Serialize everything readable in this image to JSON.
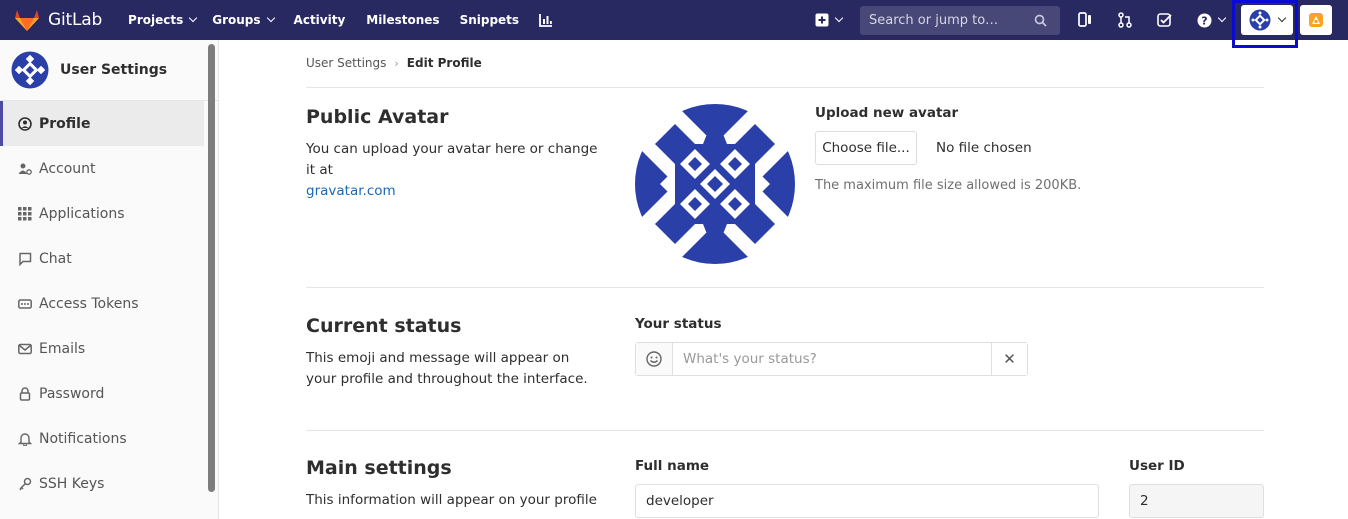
{
  "topbar": {
    "brand": "GitLab",
    "nav": [
      "Projects",
      "Groups",
      "Activity",
      "Milestones",
      "Snippets"
    ],
    "search_placeholder": "Search or jump to…"
  },
  "sidebar": {
    "title": "User Settings",
    "items": [
      {
        "label": "Profile",
        "icon": "profile-icon",
        "active": true
      },
      {
        "label": "Account",
        "icon": "account-icon"
      },
      {
        "label": "Applications",
        "icon": "applications-icon"
      },
      {
        "label": "Chat",
        "icon": "chat-icon"
      },
      {
        "label": "Access Tokens",
        "icon": "token-icon"
      },
      {
        "label": "Emails",
        "icon": "email-icon"
      },
      {
        "label": "Password",
        "icon": "lock-icon"
      },
      {
        "label": "Notifications",
        "icon": "bell-icon"
      },
      {
        "label": "SSH Keys",
        "icon": "key-icon"
      }
    ]
  },
  "breadcrumb": {
    "parent": "User Settings",
    "sep": "›",
    "current": "Edit Profile"
  },
  "avatar_section": {
    "title": "Public Avatar",
    "desc": "You can upload your avatar here or change it at",
    "link": "gravatar.com",
    "upload_label": "Upload new avatar",
    "choose_button": "Choose file...",
    "no_file": "No file chosen",
    "help": "The maximum file size allowed is 200KB."
  },
  "status_section": {
    "title": "Current status",
    "desc": "This emoji and message will appear on your profile and throughout the interface.",
    "label": "Your status",
    "placeholder": "What's your status?",
    "clear": "✕"
  },
  "main_section": {
    "title": "Main settings",
    "desc": "This information will appear on your profile",
    "full_name_label": "Full name",
    "full_name_value": "developer",
    "user_id_label": "User ID",
    "user_id_value": "2"
  },
  "colors": {
    "navbar": "#292961",
    "link": "#1b69b6",
    "avatar": "#2a3fa7",
    "active_border": "#4b4ba3"
  }
}
